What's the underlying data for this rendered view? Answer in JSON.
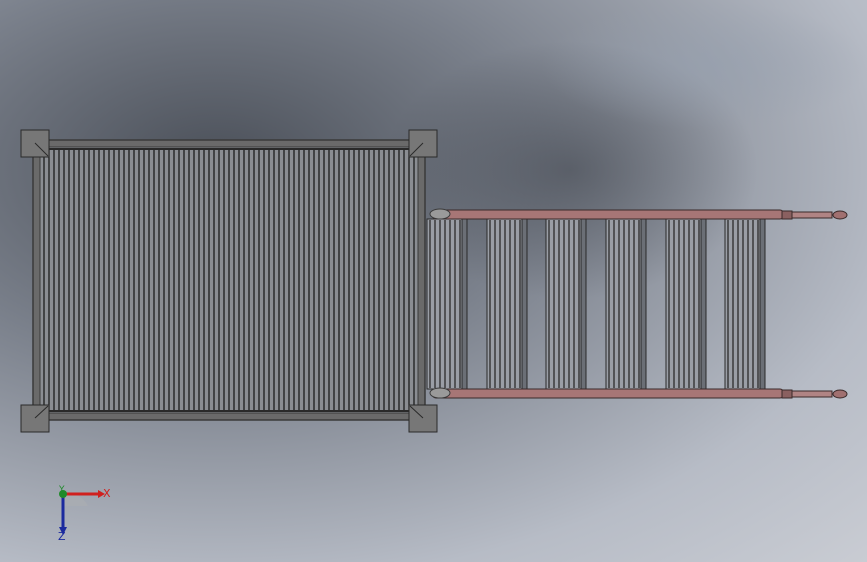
{
  "viewport": {
    "background": "gradient-gray",
    "model": {
      "platform_color": "#5a5a5a",
      "grate_color": "#1c1c1c",
      "ladder_rail_color": "#a77676",
      "ladder_tread_color": "#2a2a2a"
    }
  },
  "triad": {
    "x_label": "X",
    "y_label": "Y",
    "z_label": "Z",
    "x_color": "#d0201e",
    "y_color": "#1f8a2a",
    "z_color": "#1b2a9e"
  }
}
